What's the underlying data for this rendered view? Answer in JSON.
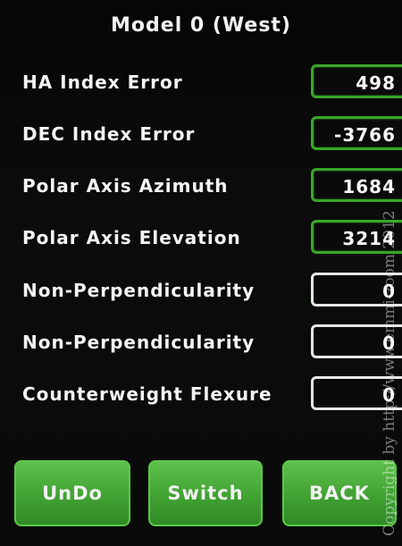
{
  "screen": {
    "title": "Model 0 (West)"
  },
  "fields": [
    {
      "label": "HA Index Error",
      "value": "498",
      "outline": "green"
    },
    {
      "label": "DEC Index Error",
      "value": "-3766",
      "outline": "green"
    },
    {
      "label": "Polar Axis Azimuth",
      "value": "1684",
      "outline": "green"
    },
    {
      "label": "Polar Axis Elevation",
      "value": "3214",
      "outline": "green"
    },
    {
      "label": "Non-Perpendicularity",
      "value": "0",
      "outline": "white"
    },
    {
      "label": "Non-Perpendicularity",
      "value": "0",
      "outline": "white"
    },
    {
      "label": "Counterweight Flexure",
      "value": "0",
      "outline": "white"
    }
  ],
  "buttons": {
    "undo": "UnDo",
    "switch": "Switch",
    "back": "BACK"
  },
  "watermark": "Copyright by http://www.emmi-zoom 2012",
  "colors": {
    "accent_green": "#3aa52a",
    "button_green": "#41a233",
    "background": "#0a0a0a"
  }
}
